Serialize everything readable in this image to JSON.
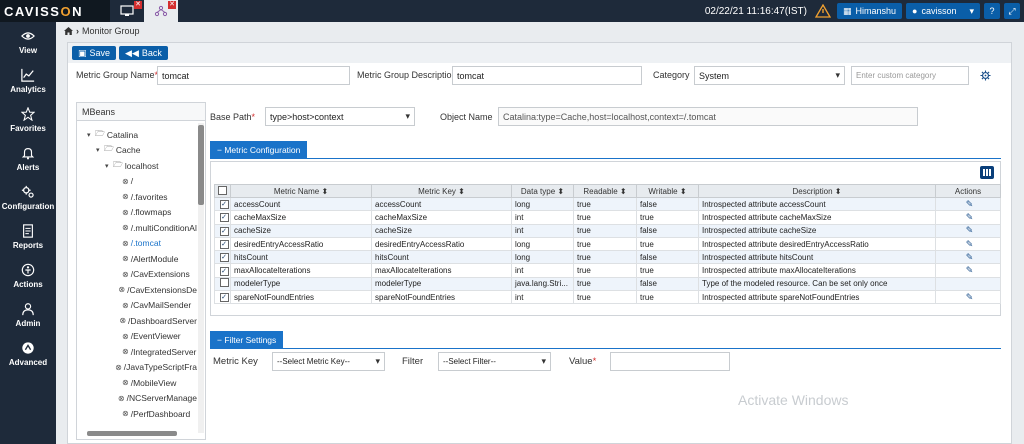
{
  "app": {
    "logo_pre": "CAVISS",
    "logo_o": "O",
    "logo_post": "N"
  },
  "topbar": {
    "datetime": "02/22/21 11:16:47(IST)",
    "user_label": "Himanshu",
    "account_label": "cavisson"
  },
  "nav": [
    {
      "label": "View",
      "icon": "eye-icon"
    },
    {
      "label": "Analytics",
      "icon": "chart-icon"
    },
    {
      "label": "Favorites",
      "icon": "star-icon"
    },
    {
      "label": "Alerts",
      "icon": "bell-icon"
    },
    {
      "label": "Configuration",
      "icon": "gears-icon"
    },
    {
      "label": "Reports",
      "icon": "report-icon"
    },
    {
      "label": "Actions",
      "icon": "actions-icon"
    },
    {
      "label": "Admin",
      "icon": "user-icon"
    },
    {
      "label": "Advanced",
      "icon": "advanced-icon"
    }
  ],
  "breadcrumb": {
    "current": "Monitor Group"
  },
  "toolbar": {
    "save_label": "Save",
    "back_label": "Back"
  },
  "form": {
    "metric_group_name_label": "Metric Group Name",
    "metric_group_name_value": "tomcat",
    "metric_group_desc_label": "Metric Group Description",
    "metric_group_desc_value": "tomcat",
    "category_label": "Category",
    "category_value": "System",
    "custom_category_placeholder": "Enter custom category",
    "base_path_label": "Base Path",
    "base_path_value": "type>host>context",
    "object_name_label": "Object Name",
    "object_name_value": "Catalina:type=Cache,host=localhost,context=/.tomcat"
  },
  "mbeans": {
    "title": "MBeans",
    "nodes": [
      {
        "label": "Catalina",
        "level": 0,
        "type": "folder",
        "expanded": true
      },
      {
        "label": "Cache",
        "level": 1,
        "type": "folder",
        "expanded": true
      },
      {
        "label": "localhost",
        "level": 2,
        "type": "folder",
        "expanded": true
      },
      {
        "label": "/",
        "level": 3,
        "type": "leaf"
      },
      {
        "label": "/.favorites",
        "level": 3,
        "type": "leaf"
      },
      {
        "label": "/.flowmaps",
        "level": 3,
        "type": "leaf"
      },
      {
        "label": "/.multiConditionAl",
        "level": 3,
        "type": "leaf"
      },
      {
        "label": "/.tomcat",
        "level": 3,
        "type": "leaf",
        "selected": true
      },
      {
        "label": "/AlertModule",
        "level": 3,
        "type": "leaf"
      },
      {
        "label": "/CavExtensions",
        "level": 3,
        "type": "leaf"
      },
      {
        "label": "/CavExtensionsDe",
        "level": 3,
        "type": "leaf"
      },
      {
        "label": "/CavMailSender",
        "level": 3,
        "type": "leaf"
      },
      {
        "label": "/DashboardServer",
        "level": 3,
        "type": "leaf"
      },
      {
        "label": "/EventViewer",
        "level": 3,
        "type": "leaf"
      },
      {
        "label": "/IntegratedServer",
        "level": 3,
        "type": "leaf"
      },
      {
        "label": "/JavaTypeScriptFra",
        "level": 3,
        "type": "leaf"
      },
      {
        "label": "/MobileView",
        "level": 3,
        "type": "leaf"
      },
      {
        "label": "/NCServerManage",
        "level": 3,
        "type": "leaf"
      },
      {
        "label": "/PerfDashboard",
        "level": 3,
        "type": "leaf"
      }
    ]
  },
  "metric_config": {
    "title": "− Metric Configuration",
    "columns": [
      "Metric Name",
      "Metric Key",
      "Data type",
      "Readable",
      "Writable",
      "Description",
      "Actions"
    ],
    "rows": [
      {
        "checked": true,
        "name": "accessCount",
        "key": "accessCount",
        "type": "long",
        "readable": "true",
        "writable": "false",
        "desc": "Introspected attribute accessCount",
        "edit": true
      },
      {
        "checked": true,
        "name": "cacheMaxSize",
        "key": "cacheMaxSize",
        "type": "int",
        "readable": "true",
        "writable": "true",
        "desc": "Introspected attribute cacheMaxSize",
        "edit": true
      },
      {
        "checked": true,
        "name": "cacheSize",
        "key": "cacheSize",
        "type": "int",
        "readable": "true",
        "writable": "false",
        "desc": "Introspected attribute cacheSize",
        "edit": true
      },
      {
        "checked": true,
        "name": "desiredEntryAccessRatio",
        "key": "desiredEntryAccessRatio",
        "type": "long",
        "readable": "true",
        "writable": "true",
        "desc": "Introspected attribute desiredEntryAccessRatio",
        "edit": true
      },
      {
        "checked": true,
        "name": "hitsCount",
        "key": "hitsCount",
        "type": "long",
        "readable": "true",
        "writable": "false",
        "desc": "Introspected attribute hitsCount",
        "edit": true
      },
      {
        "checked": true,
        "name": "maxAllocateIterations",
        "key": "maxAllocateIterations",
        "type": "int",
        "readable": "true",
        "writable": "true",
        "desc": "Introspected attribute maxAllocateIterations",
        "edit": true
      },
      {
        "checked": false,
        "name": "modelerType",
        "key": "modelerType",
        "type": "java.lang.Stri...",
        "readable": "true",
        "writable": "false",
        "desc": "Type of the modeled resource. Can be set only once",
        "edit": false
      },
      {
        "checked": true,
        "name": "spareNotFoundEntries",
        "key": "spareNotFoundEntries",
        "type": "int",
        "readable": "true",
        "writable": "true",
        "desc": "Introspected attribute spareNotFoundEntries",
        "edit": true
      }
    ]
  },
  "filter": {
    "title": "− Filter Settings",
    "metric_key_label": "Metric Key",
    "metric_key_value": "--Select Metric Key--",
    "filter_label": "Filter",
    "filter_value": "--Select Filter--",
    "value_label": "Value"
  },
  "watermark": "Activate Windows"
}
